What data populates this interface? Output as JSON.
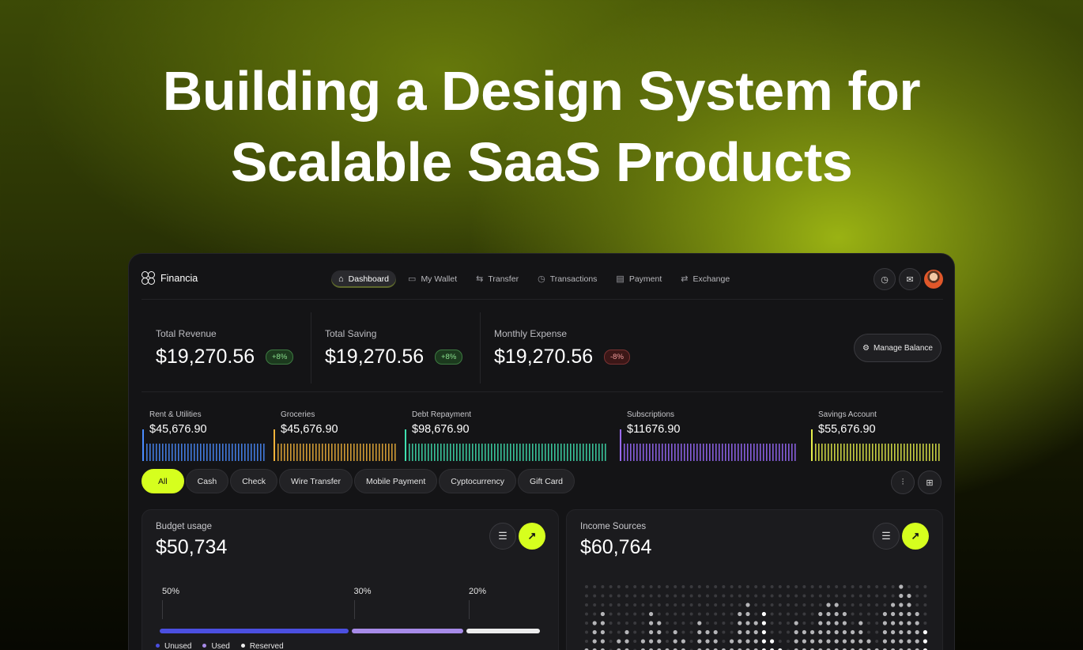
{
  "hero": {
    "title_line1": "Building a Design System for",
    "title_line2": "Scalable SaaS Products"
  },
  "app": {
    "brand": "Financia",
    "nav": [
      {
        "label": "Dashboard",
        "icon": "home-icon",
        "glyph": "⌂",
        "active": true
      },
      {
        "label": "My Wallet",
        "icon": "wallet-icon",
        "glyph": "▭",
        "active": false
      },
      {
        "label": "Transfer",
        "icon": "transfer-icon",
        "glyph": "⇆",
        "active": false
      },
      {
        "label": "Transactions",
        "icon": "clock-icon",
        "glyph": "◷",
        "active": false
      },
      {
        "label": "Payment",
        "icon": "card-icon",
        "glyph": "▤",
        "active": false
      },
      {
        "label": "Exchange",
        "icon": "exchange-icon",
        "glyph": "⇄",
        "active": false
      }
    ],
    "stats": [
      {
        "label": "Total Revenue",
        "value": "$19,270.56",
        "badge": "+8%",
        "trend": "up"
      },
      {
        "label": "Total Saving",
        "value": "$19,270.56",
        "badge": "+8%",
        "trend": "up"
      },
      {
        "label": "Monthly Expense",
        "value": "$19,270.56",
        "badge": "-8%",
        "trend": "down"
      }
    ],
    "manage_balance": "Manage Balance",
    "categories": [
      {
        "label": "Rent & Utilities",
        "value": "$45,676.90",
        "color": "#4a8cff"
      },
      {
        "label": "Groceries",
        "value": "$45,676.90",
        "color": "#f0b23a"
      },
      {
        "label": "Debt Repayment",
        "value": "$98,676.90",
        "color": "#3fe0b0"
      },
      {
        "label": "Subscriptions",
        "value": "$11676.90",
        "color": "#9b6bff"
      },
      {
        "label": "Savings Account",
        "value": "$55,676.90",
        "color": "#e6f04a"
      }
    ],
    "filters": [
      "All",
      "Cash",
      "Check",
      "Wire Transfer",
      "Mobile Payment",
      "Cyptocurrency",
      "Gift Card"
    ],
    "active_filter": "All",
    "budget": {
      "title": "Budget usage",
      "value": "$50,734",
      "segments": [
        {
          "label": "Unused",
          "percent": "50%",
          "fraction": 0.5,
          "color": "#4b4fe0"
        },
        {
          "label": "Used",
          "percent": "30%",
          "fraction": 0.3,
          "color": "#a78be8"
        },
        {
          "label": "Reserved",
          "percent": "20%",
          "fraction": 0.2,
          "color": "#ededed"
        }
      ]
    },
    "income": {
      "title": "Income Sources",
      "value": "$60,764"
    },
    "colors": {
      "accent": "#d6ff1e",
      "panel": "#141416",
      "card": "#1b1b1e"
    }
  }
}
